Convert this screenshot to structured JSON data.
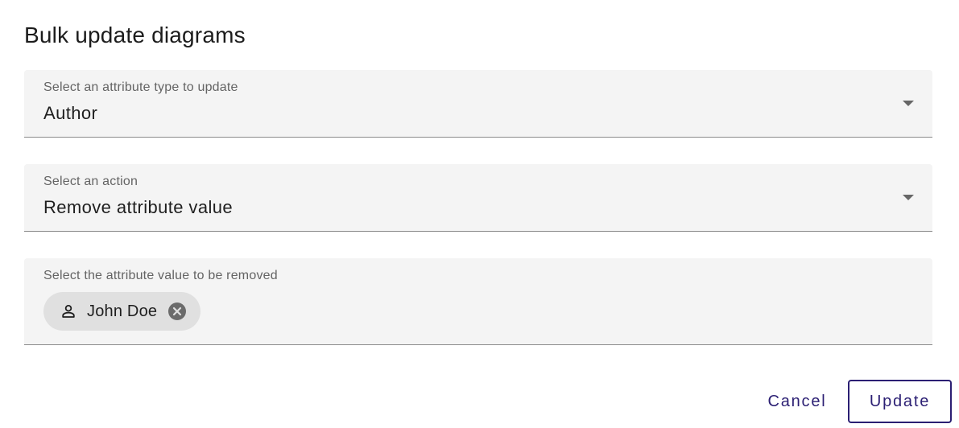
{
  "dialog": {
    "title": "Bulk update diagrams"
  },
  "fields": {
    "attribute_type": {
      "label": "Select an attribute type to update",
      "value": "Author"
    },
    "action": {
      "label": "Select an action",
      "value": "Remove attribute value"
    },
    "attribute_values": {
      "label": "Select the attribute value to be removed",
      "chips": [
        {
          "label": "John Doe",
          "icon": "person-outline-icon",
          "remove_icon": "cancel-circle-icon"
        }
      ]
    }
  },
  "actions": {
    "cancel_label": "Cancel",
    "update_label": "Update"
  },
  "colors": {
    "accent": "#2b1f73",
    "field_background": "#f4f4f4",
    "chip_background": "#e0e0e0"
  }
}
